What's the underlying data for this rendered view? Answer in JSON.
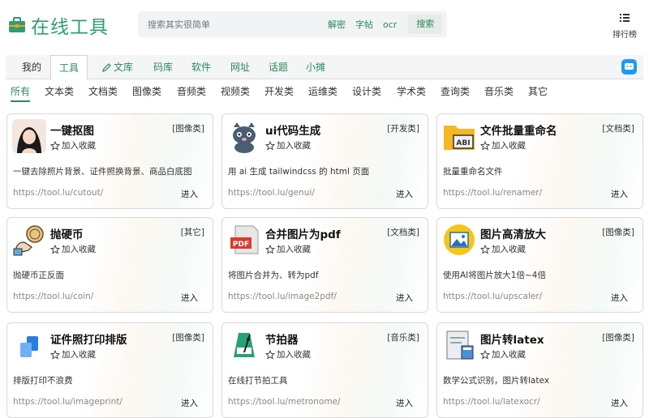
{
  "header": {
    "logo_text": "在线工具",
    "search_placeholder": "搜索其实很简单",
    "search_chips": [
      "解密",
      "字帖",
      "ocr"
    ],
    "search_button": "搜索",
    "rank_label": "排行榜"
  },
  "nav": {
    "items": [
      {
        "label": "我的",
        "style": "plain"
      },
      {
        "label": "工具",
        "style": "active"
      },
      {
        "label": "文库",
        "style": "link"
      },
      {
        "label": "码库",
        "style": "link"
      },
      {
        "label": "软件",
        "style": "link"
      },
      {
        "label": "网址",
        "style": "link"
      },
      {
        "label": "话题",
        "style": "link"
      },
      {
        "label": "小摊",
        "style": "link"
      }
    ]
  },
  "categories": [
    "所有",
    "文本类",
    "文档类",
    "图像类",
    "音频类",
    "视频类",
    "开发类",
    "运维类",
    "设计类",
    "学术类",
    "查询类",
    "音乐类",
    "其它"
  ],
  "fav_label": "加入收藏",
  "enter_label": "进入",
  "cards": [
    {
      "title": "一键抠图",
      "tag": "[图像类]",
      "desc": "一键去除照片背景、证件照换背景、商品白底图",
      "url": "https://tool.lu/cutout/",
      "icon": "portrait-icon"
    },
    {
      "title": "ui代码生成",
      "tag": "[开发类]",
      "desc": "用 ai 生成 tailwindcss 的 html 页面",
      "url": "https://tool.lu/genui/",
      "icon": "cat-icon"
    },
    {
      "title": "文件批量重命名",
      "tag": "[文档类]",
      "desc": "批量重命名文件",
      "url": "https://tool.lu/renamer/",
      "icon": "folder-abi-icon"
    },
    {
      "title": "抛硬币",
      "tag": "[其它]",
      "desc": "抛硬币正反面",
      "url": "https://tool.lu/coin/",
      "icon": "coin-hand-icon"
    },
    {
      "title": "合并图片为pdf",
      "tag": "[文档类]",
      "desc": "将图片合并为、转为pdf",
      "url": "https://tool.lu/image2pdf/",
      "icon": "pdf-icon"
    },
    {
      "title": "图片高清放大",
      "tag": "[图像类]",
      "desc": "使用AI将图片放大1倍~4倍",
      "url": "https://tool.lu/upscaler/",
      "icon": "image-upscale-icon"
    },
    {
      "title": "证件照打印排版",
      "tag": "[图像类]",
      "desc": "排版打印不浪费",
      "url": "https://tool.lu/imageprint/",
      "icon": "layout-icon"
    },
    {
      "title": "节拍器",
      "tag": "[音乐类]",
      "desc": "在线打节拍工具",
      "url": "https://tool.lu/metronome/",
      "icon": "metronome-icon"
    },
    {
      "title": "图片转latex",
      "tag": "[图像类]",
      "desc": "数学公式识别，图片转latex",
      "url": "https://tool.lu/latexocr/",
      "icon": "formula-icon"
    }
  ]
}
